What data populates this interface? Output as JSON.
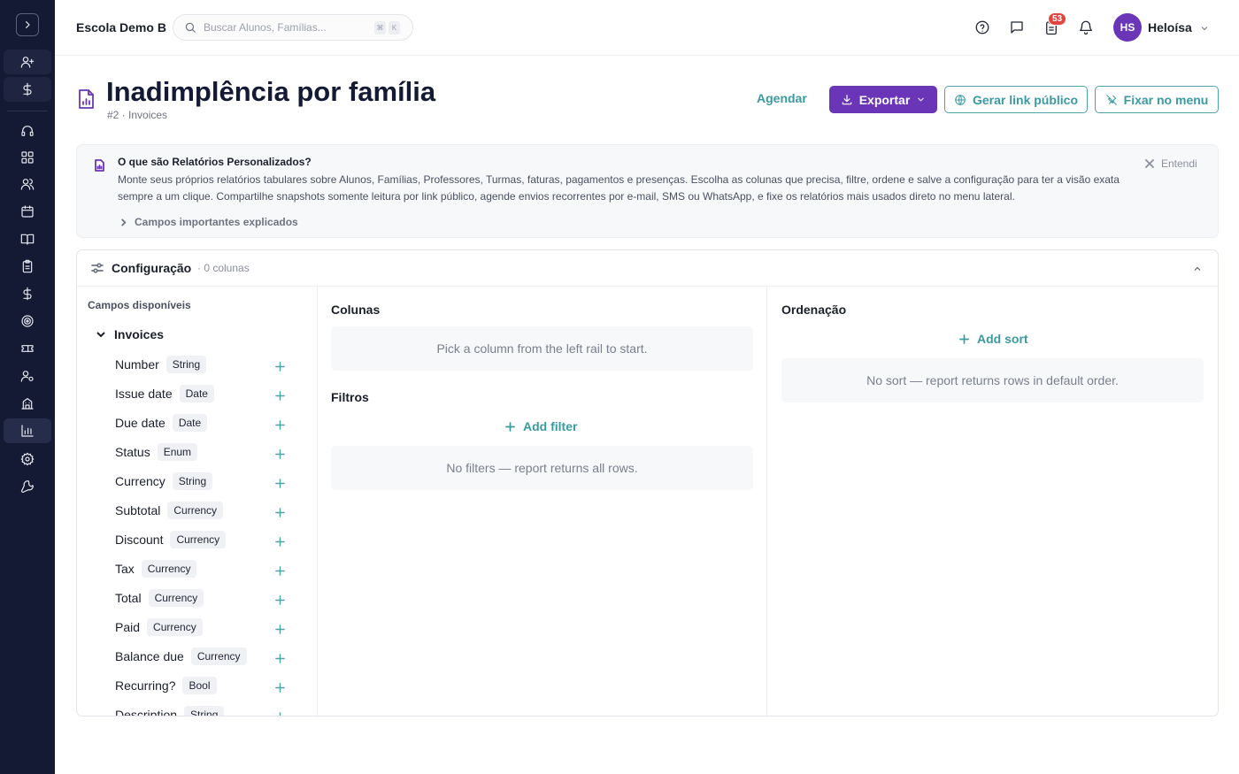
{
  "topbar": {
    "school_name": "Escola Demo B",
    "search_placeholder": "Buscar Alunos, Famílias...",
    "shortcut_keys": [
      "⌘",
      "K"
    ],
    "tasks_badge": "53",
    "user_initials": "HS",
    "user_name": "Heloísa"
  },
  "sidebar": {
    "icons": [
      "user-plus-icon",
      "dollar-icon",
      "headset-icon",
      "grid-icon",
      "users-icon",
      "calendar-icon",
      "book-icon",
      "clipboard-icon",
      "dollar-icon",
      "target-icon",
      "ticket-icon",
      "user-settings-icon",
      "building-icon",
      "bar-chart-icon",
      "settings-icon",
      "wrench-icon"
    ],
    "active": "bar-chart-icon"
  },
  "header": {
    "title": "Inadimplência por família",
    "subtitle": "#2 · Invoices",
    "schedule_label": "Agendar",
    "export_label": "Exportar",
    "public_link_label": "Gerar link público",
    "pin_label": "Fixar no menu"
  },
  "info": {
    "title": "O que são Relatórios Personalizados?",
    "text": "Monte seus próprios relatórios tabulares sobre Alunos, Famílias, Professores, Turmas, faturas, pagamentos e presenças. Escolha as colunas que precisa, filtre, ordene e salve a configuração para ter a visão exata sempre a um clique. Compartilhe snapshots somente leitura por link público, agende envios recorrentes por e-mail, SMS ou WhatsApp, e fixe os relatórios mais usados direto no menu lateral.",
    "dismiss_label": "Entendi",
    "expand_label": "Campos importantes explicados"
  },
  "config": {
    "title": "Configuração",
    "count": "· 0 colunas",
    "fields_label": "Campos disponíveis",
    "group_name": "Invoices",
    "fields": [
      {
        "name": "Number",
        "type": "String"
      },
      {
        "name": "Issue date",
        "type": "Date"
      },
      {
        "name": "Due date",
        "type": "Date"
      },
      {
        "name": "Status",
        "type": "Enum"
      },
      {
        "name": "Currency",
        "type": "String"
      },
      {
        "name": "Subtotal",
        "type": "Currency"
      },
      {
        "name": "Discount",
        "type": "Currency"
      },
      {
        "name": "Tax",
        "type": "Currency"
      },
      {
        "name": "Total",
        "type": "Currency"
      },
      {
        "name": "Paid",
        "type": "Currency"
      },
      {
        "name": "Balance due",
        "type": "Currency"
      },
      {
        "name": "Recurring?",
        "type": "Bool"
      },
      {
        "name": "Description",
        "type": "String"
      }
    ],
    "columns_title": "Colunas",
    "columns_empty": "Pick a column from the left rail to start.",
    "filters_title": "Filtros",
    "add_filter_label": "Add filter",
    "filters_empty": "No filters — report returns all rows.",
    "sort_title": "Ordenação",
    "add_sort_label": "Add sort",
    "sort_empty": "No sort — report returns rows in default order."
  },
  "colors": {
    "sidebar_bg": "#141a33",
    "accent_purple": "#6b35b8",
    "accent_teal": "#3a9aa2",
    "badge_red": "#e0453f"
  }
}
